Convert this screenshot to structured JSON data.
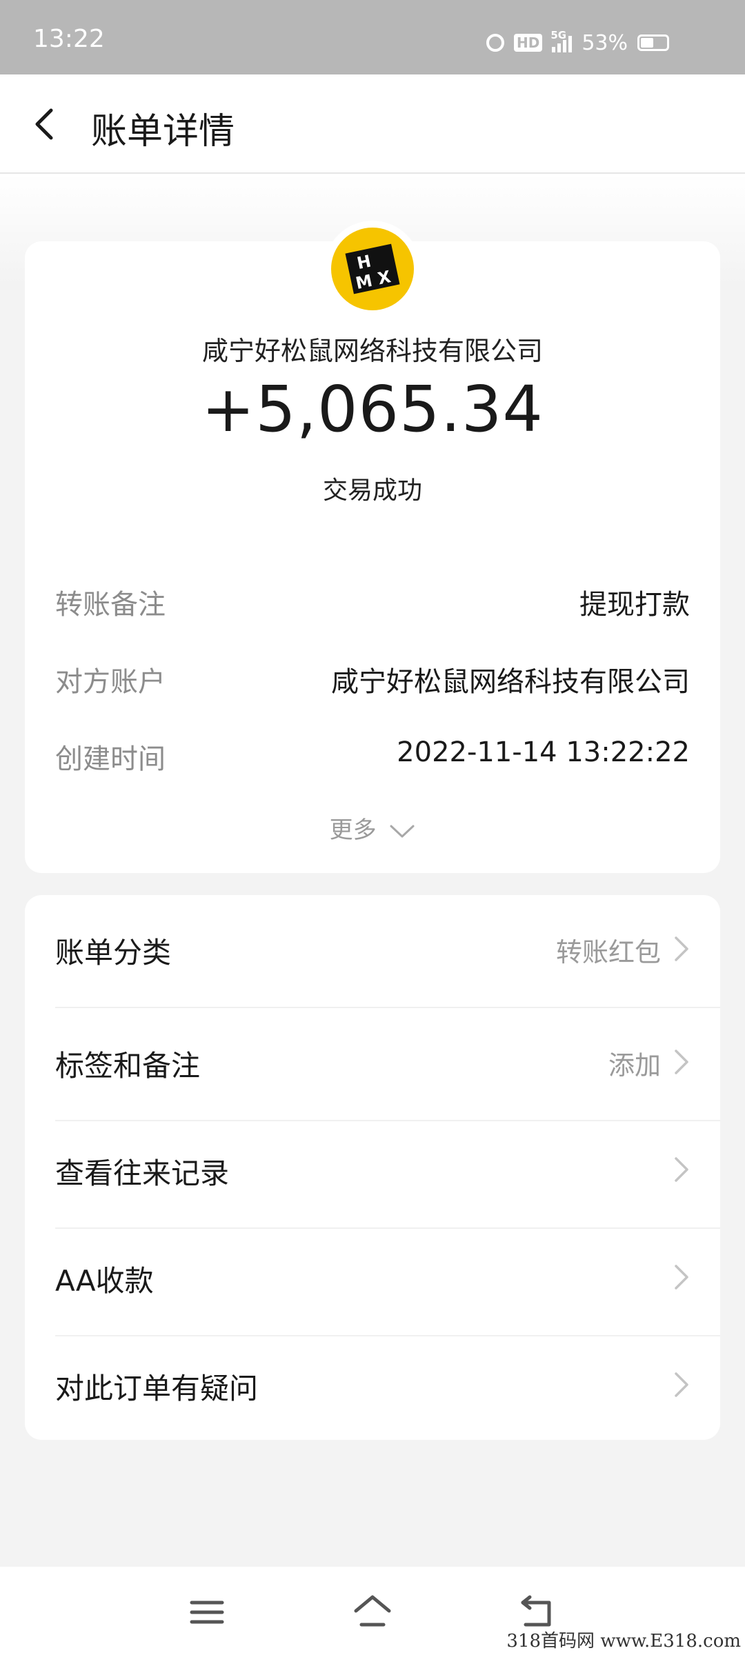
{
  "status_bar": {
    "time": "13:22",
    "hd_label": "HD",
    "network": "5G",
    "battery": "53%",
    "battery_level": 0.53
  },
  "header": {
    "title": "账单详情"
  },
  "transaction": {
    "counterparty": "咸宁好松鼠网络科技有限公司",
    "amount": "+5,065.34",
    "status": "交易成功",
    "logo_text": [
      "H",
      "M",
      "X"
    ]
  },
  "details": [
    {
      "label": "转账备注",
      "value": "提现打款"
    },
    {
      "label": "对方账户",
      "value": "咸宁好松鼠网络科技有限公司"
    },
    {
      "label": "创建时间",
      "value": "2022-11-14 13:22:22"
    }
  ],
  "more_label": "更多",
  "menu": [
    {
      "label": "账单分类",
      "value": "转账红包"
    },
    {
      "label": "标签和备注",
      "value": "添加"
    },
    {
      "label": "查看往来记录",
      "value": ""
    },
    {
      "label": "AA收款",
      "value": ""
    },
    {
      "label": "对此订单有疑问",
      "value": ""
    }
  ],
  "watermark": "318首码网 www.E318.com",
  "colors": {
    "status_bar": "#b7b7b7",
    "logo_bg": "#f6c400",
    "label_gray": "#8c8c8c"
  }
}
